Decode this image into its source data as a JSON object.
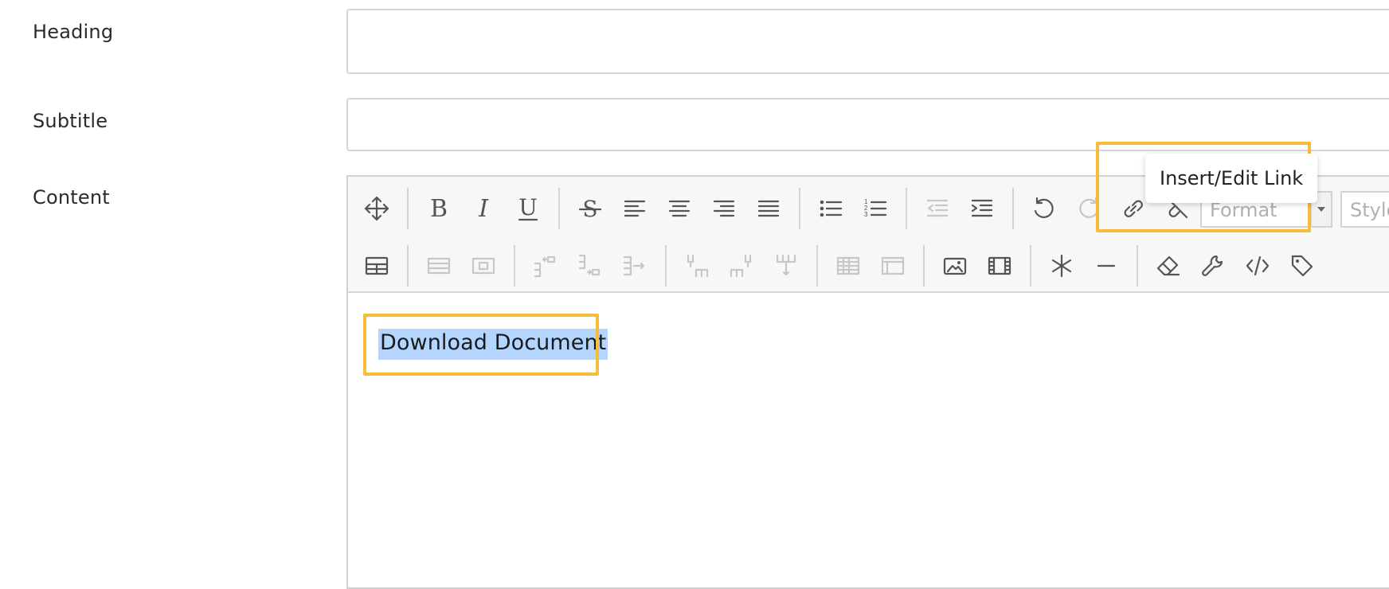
{
  "form": {
    "heading_label": "Heading",
    "heading_value": "",
    "subtitle_label": "Subtitle",
    "subtitle_value": "",
    "content_label": "Content"
  },
  "toolbar": {
    "row1": [
      "move",
      "bold",
      "italic",
      "underline",
      "strikethrough",
      "align-left",
      "align-center",
      "align-right",
      "align-justify",
      "bullet-list",
      "numbered-list",
      "outdent",
      "indent",
      "undo",
      "redo",
      "insert-link",
      "remove-link"
    ],
    "row2": [
      "table",
      "table-row-props",
      "table-cell-props",
      "insert-row-before",
      "insert-row-after",
      "delete-row",
      "insert-col-before",
      "insert-col-after",
      "delete-col",
      "split-cells",
      "merge-cells",
      "image",
      "media",
      "special-char",
      "horizontal-rule",
      "clear-formatting",
      "tools",
      "source-code",
      "anchor"
    ],
    "bold_glyph": "B",
    "italic_glyph": "I",
    "underline_glyph": "U",
    "strike_glyph": "S",
    "format_placeholder": "Format",
    "styles_placeholder": "Style"
  },
  "editor": {
    "selected_text": "Download Document"
  },
  "tooltip": {
    "text": "Insert/Edit Link"
  },
  "colors": {
    "highlight": "#f6bd3b",
    "selection": "#b4d5fe",
    "toolbar_bg": "#f7f7f7"
  }
}
